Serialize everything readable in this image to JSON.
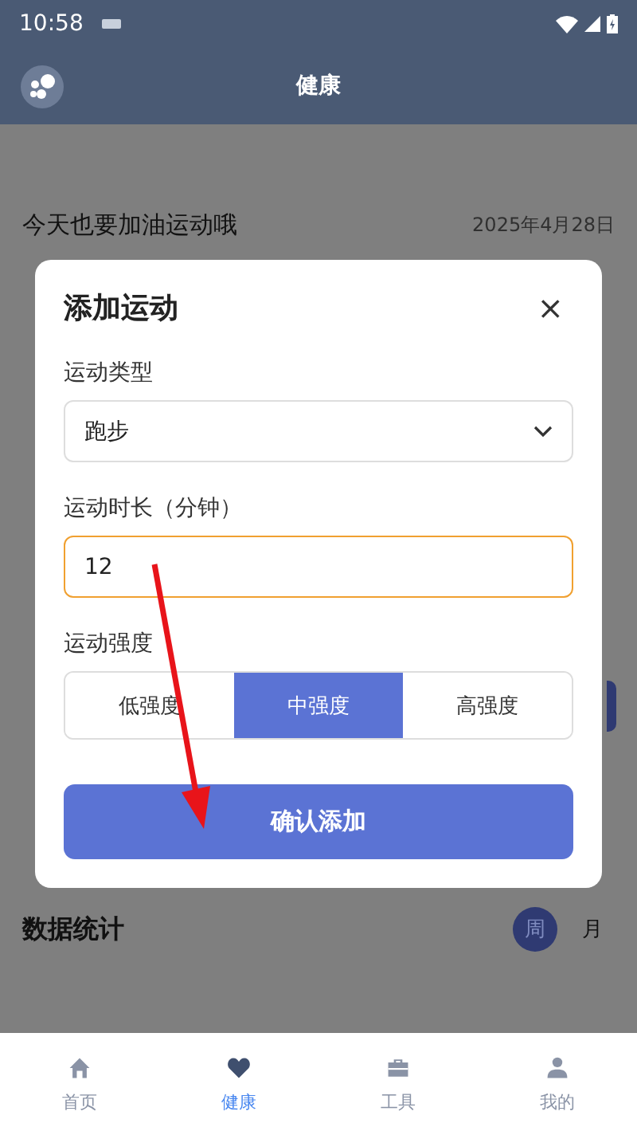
{
  "status_bar": {
    "time": "10:58"
  },
  "app_bar": {
    "title": "健康"
  },
  "background": {
    "greeting": "今天也要加油运动哦",
    "date": "2025年4月28日",
    "stats_title": "数据统计",
    "period_tabs": [
      {
        "label": "周",
        "selected": true
      },
      {
        "label": "月",
        "selected": false
      }
    ]
  },
  "dialog": {
    "title": "添加运动",
    "close": "×",
    "fields": [
      {
        "kind": "select",
        "label": "运动类型",
        "value": "跑步",
        "focused": false
      },
      {
        "kind": "input",
        "label": "运动时长（分钟）",
        "value": "12",
        "focused": true
      }
    ],
    "intensity": {
      "label": "运动强度",
      "options": [
        {
          "label": "低强度",
          "selected": false
        },
        {
          "label": "中强度",
          "selected": true
        },
        {
          "label": "高强度",
          "selected": false
        }
      ]
    },
    "submit": "确认添加"
  },
  "bottom_nav": [
    {
      "label": "首页",
      "selected": false
    },
    {
      "label": "健康",
      "selected": true
    },
    {
      "label": "工具",
      "selected": false
    },
    {
      "label": "我的",
      "selected": false
    }
  ]
}
